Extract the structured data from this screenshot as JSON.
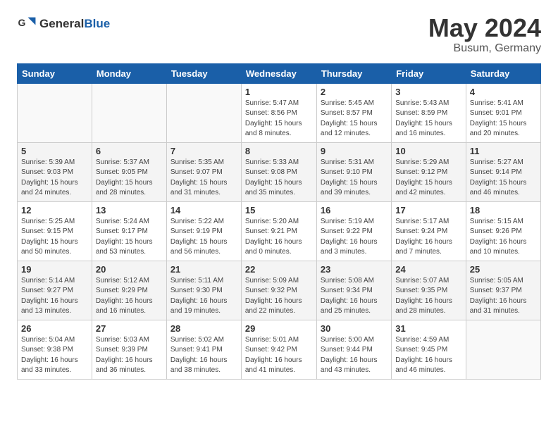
{
  "header": {
    "logo_general": "General",
    "logo_blue": "Blue",
    "month_title": "May 2024",
    "subtitle": "Busum, Germany"
  },
  "weekdays": [
    "Sunday",
    "Monday",
    "Tuesday",
    "Wednesday",
    "Thursday",
    "Friday",
    "Saturday"
  ],
  "weeks": [
    [
      {
        "day": "",
        "info": ""
      },
      {
        "day": "",
        "info": ""
      },
      {
        "day": "",
        "info": ""
      },
      {
        "day": "1",
        "info": "Sunrise: 5:47 AM\nSunset: 8:56 PM\nDaylight: 15 hours\nand 8 minutes."
      },
      {
        "day": "2",
        "info": "Sunrise: 5:45 AM\nSunset: 8:57 PM\nDaylight: 15 hours\nand 12 minutes."
      },
      {
        "day": "3",
        "info": "Sunrise: 5:43 AM\nSunset: 8:59 PM\nDaylight: 15 hours\nand 16 minutes."
      },
      {
        "day": "4",
        "info": "Sunrise: 5:41 AM\nSunset: 9:01 PM\nDaylight: 15 hours\nand 20 minutes."
      }
    ],
    [
      {
        "day": "5",
        "info": "Sunrise: 5:39 AM\nSunset: 9:03 PM\nDaylight: 15 hours\nand 24 minutes."
      },
      {
        "day": "6",
        "info": "Sunrise: 5:37 AM\nSunset: 9:05 PM\nDaylight: 15 hours\nand 28 minutes."
      },
      {
        "day": "7",
        "info": "Sunrise: 5:35 AM\nSunset: 9:07 PM\nDaylight: 15 hours\nand 31 minutes."
      },
      {
        "day": "8",
        "info": "Sunrise: 5:33 AM\nSunset: 9:08 PM\nDaylight: 15 hours\nand 35 minutes."
      },
      {
        "day": "9",
        "info": "Sunrise: 5:31 AM\nSunset: 9:10 PM\nDaylight: 15 hours\nand 39 minutes."
      },
      {
        "day": "10",
        "info": "Sunrise: 5:29 AM\nSunset: 9:12 PM\nDaylight: 15 hours\nand 42 minutes."
      },
      {
        "day": "11",
        "info": "Sunrise: 5:27 AM\nSunset: 9:14 PM\nDaylight: 15 hours\nand 46 minutes."
      }
    ],
    [
      {
        "day": "12",
        "info": "Sunrise: 5:25 AM\nSunset: 9:15 PM\nDaylight: 15 hours\nand 50 minutes."
      },
      {
        "day": "13",
        "info": "Sunrise: 5:24 AM\nSunset: 9:17 PM\nDaylight: 15 hours\nand 53 minutes."
      },
      {
        "day": "14",
        "info": "Sunrise: 5:22 AM\nSunset: 9:19 PM\nDaylight: 15 hours\nand 56 minutes."
      },
      {
        "day": "15",
        "info": "Sunrise: 5:20 AM\nSunset: 9:21 PM\nDaylight: 16 hours\nand 0 minutes."
      },
      {
        "day": "16",
        "info": "Sunrise: 5:19 AM\nSunset: 9:22 PM\nDaylight: 16 hours\nand 3 minutes."
      },
      {
        "day": "17",
        "info": "Sunrise: 5:17 AM\nSunset: 9:24 PM\nDaylight: 16 hours\nand 7 minutes."
      },
      {
        "day": "18",
        "info": "Sunrise: 5:15 AM\nSunset: 9:26 PM\nDaylight: 16 hours\nand 10 minutes."
      }
    ],
    [
      {
        "day": "19",
        "info": "Sunrise: 5:14 AM\nSunset: 9:27 PM\nDaylight: 16 hours\nand 13 minutes."
      },
      {
        "day": "20",
        "info": "Sunrise: 5:12 AM\nSunset: 9:29 PM\nDaylight: 16 hours\nand 16 minutes."
      },
      {
        "day": "21",
        "info": "Sunrise: 5:11 AM\nSunset: 9:30 PM\nDaylight: 16 hours\nand 19 minutes."
      },
      {
        "day": "22",
        "info": "Sunrise: 5:09 AM\nSunset: 9:32 PM\nDaylight: 16 hours\nand 22 minutes."
      },
      {
        "day": "23",
        "info": "Sunrise: 5:08 AM\nSunset: 9:34 PM\nDaylight: 16 hours\nand 25 minutes."
      },
      {
        "day": "24",
        "info": "Sunrise: 5:07 AM\nSunset: 9:35 PM\nDaylight: 16 hours\nand 28 minutes."
      },
      {
        "day": "25",
        "info": "Sunrise: 5:05 AM\nSunset: 9:37 PM\nDaylight: 16 hours\nand 31 minutes."
      }
    ],
    [
      {
        "day": "26",
        "info": "Sunrise: 5:04 AM\nSunset: 9:38 PM\nDaylight: 16 hours\nand 33 minutes."
      },
      {
        "day": "27",
        "info": "Sunrise: 5:03 AM\nSunset: 9:39 PM\nDaylight: 16 hours\nand 36 minutes."
      },
      {
        "day": "28",
        "info": "Sunrise: 5:02 AM\nSunset: 9:41 PM\nDaylight: 16 hours\nand 38 minutes."
      },
      {
        "day": "29",
        "info": "Sunrise: 5:01 AM\nSunset: 9:42 PM\nDaylight: 16 hours\nand 41 minutes."
      },
      {
        "day": "30",
        "info": "Sunrise: 5:00 AM\nSunset: 9:44 PM\nDaylight: 16 hours\nand 43 minutes."
      },
      {
        "day": "31",
        "info": "Sunrise: 4:59 AM\nSunset: 9:45 PM\nDaylight: 16 hours\nand 46 minutes."
      },
      {
        "day": "",
        "info": ""
      }
    ]
  ]
}
